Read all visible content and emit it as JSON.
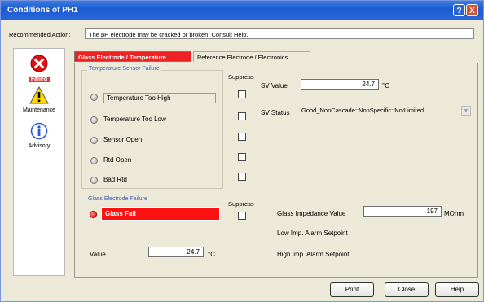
{
  "window": {
    "title": "Conditions of PH1",
    "help_button": "?",
    "close_button": "X"
  },
  "recommended": {
    "label": "Recommended Action:",
    "text": "The pH electrode may be cracked or broken.  Consult Help."
  },
  "sidebar": {
    "items": [
      {
        "label": "Failed",
        "icon": "error-icon"
      },
      {
        "label": "Maintenance",
        "icon": "warning-icon"
      },
      {
        "label": "Advisory",
        "icon": "info-icon"
      }
    ]
  },
  "tabs": [
    {
      "label": "Glass Electrode / Temperature",
      "active": true
    },
    {
      "label": "Reference Electrode / Electronics",
      "active": false
    }
  ],
  "temperature": {
    "group_title": "Temperature Sensor Failure",
    "suppress_label": "Suppress",
    "sensors": [
      {
        "label": "Temperature Too High",
        "boxed": true
      },
      {
        "label": "Temperature Too Low"
      },
      {
        "label": "Sensor Open"
      },
      {
        "label": "Rtd Open"
      },
      {
        "label": "Bad Rtd"
      }
    ],
    "sv_value_label": "SV Value",
    "sv_value": "24.7",
    "sv_unit": "°C",
    "sv_status_label": "SV Status",
    "sv_status": "Good_NonCascade::NonSpecific::NotLimited"
  },
  "glass": {
    "group_title": "Glass Electrode Failure",
    "suppress_label": "Suppress",
    "fail_label": "Glass Fail",
    "impedance_label": "Glass Impedance Value",
    "impedance_value": "197",
    "impedance_unit": "MOhm",
    "low_label": "Low Imp. Alarm Setpoint",
    "high_label": "High Imp. Alarm Setpoint",
    "value_label": "Value",
    "value": "24.7",
    "value_unit": "°C"
  },
  "buttons": {
    "print": "Print",
    "close": "Close",
    "help": "Help"
  },
  "colors": {
    "failed_red": "#ee2222",
    "title_blue": "#2a66da",
    "group_title_blue": "#3a5bbf"
  }
}
